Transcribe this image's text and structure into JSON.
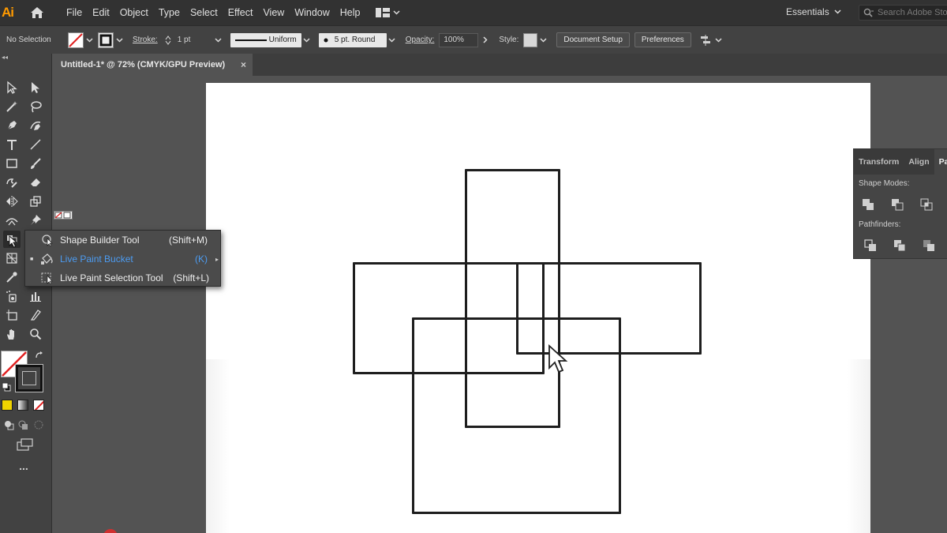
{
  "app": {
    "logo": "Ai"
  },
  "menu": [
    "File",
    "Edit",
    "Object",
    "Type",
    "Select",
    "Effect",
    "View",
    "Window",
    "Help"
  ],
  "workspace": {
    "label": "Essentials"
  },
  "search": {
    "placeholder": "Search Adobe Sto"
  },
  "control_bar": {
    "selection": "No Selection",
    "stroke_label": "Stroke:",
    "stroke_weight": "1 pt",
    "profile": "Uniform",
    "brush": "5 pt. Round",
    "opacity_label": "Opacity:",
    "opacity_value": "100%",
    "style_label": "Style:",
    "document_setup": "Document Setup",
    "preferences": "Preferences"
  },
  "tab": {
    "title": "Untitled-1* @ 72% (CMYK/GPU Preview)",
    "close": "×"
  },
  "flyout": [
    {
      "label": "Shape Builder Tool",
      "shortcut": "(Shift+M)",
      "active": false
    },
    {
      "label": "Live Paint Bucket",
      "shortcut": "(K)",
      "active": true
    },
    {
      "label": "Live Paint Selection Tool",
      "shortcut": "(Shift+L)",
      "active": false
    }
  ],
  "panel": {
    "tabs": [
      "Transform",
      "Align",
      "Pa"
    ],
    "shape_modes_label": "Shape Modes:",
    "pathfinders_label": "Pathfinders:"
  },
  "toolbar": {
    "more": "..."
  },
  "colors": {
    "accent_active": "#4c9cf2",
    "app_logo": "#ff9a00",
    "ui_dark": "#323232",
    "ui_mid": "#424242",
    "canvas_bg": "#535353"
  }
}
